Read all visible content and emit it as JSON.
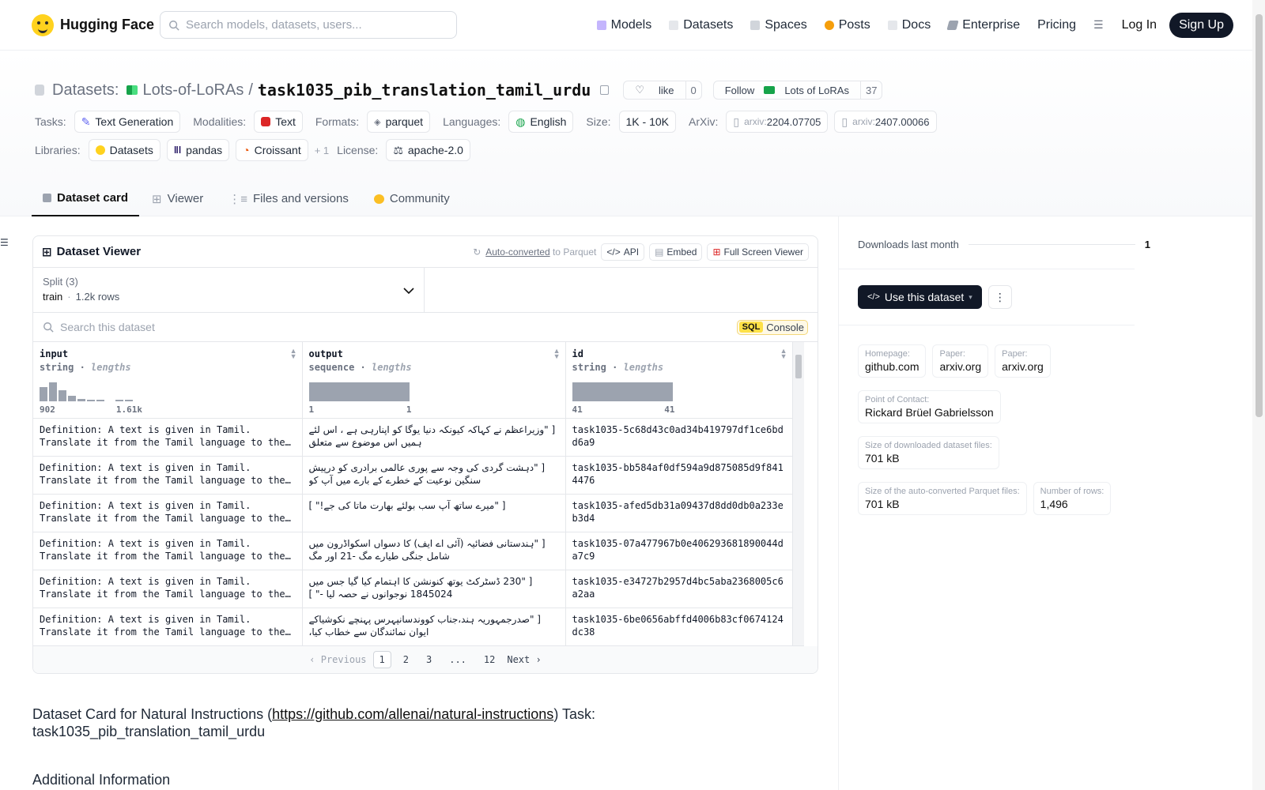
{
  "header": {
    "brand": "Hugging Face",
    "search_placeholder": "Search models, datasets, users...",
    "nav": [
      {
        "label": "Models",
        "icon": "cube-icon",
        "color": "#a78bfa"
      },
      {
        "label": "Datasets",
        "icon": "database-icon",
        "color": "#f87171"
      },
      {
        "label": "Spaces",
        "icon": "grid-icon",
        "color": "#60a5fa"
      },
      {
        "label": "Posts",
        "icon": "chat-icon",
        "color": "#f59e0b"
      },
      {
        "label": "Docs",
        "icon": "book-icon",
        "color": "#9ca3af"
      },
      {
        "label": "Enterprise",
        "icon": "enterprise-icon",
        "color": "#6b7280"
      },
      {
        "label": "Pricing"
      }
    ],
    "login": "Log In",
    "signup": "Sign Up"
  },
  "repo": {
    "section": "Datasets:",
    "owner": "Lots-of-LoRAs",
    "slash": "/",
    "name": "task1035_pib_translation_tamil_urdu",
    "like_label": "like",
    "like_count": "0",
    "follow_label": "Follow",
    "follow_org": "Lots of LoRAs",
    "follow_count": "37"
  },
  "meta": {
    "tasks_label": "Tasks:",
    "task": "Text Generation",
    "modalities_label": "Modalities:",
    "modality": "Text",
    "formats_label": "Formats:",
    "format": "parquet",
    "languages_label": "Languages:",
    "language": "English",
    "size_label": "Size:",
    "size": "1K - 10K",
    "arxiv_label": "ArXiv:",
    "arxiv_prefix": "arxiv:",
    "arxiv1": "2204.07705",
    "arxiv2": "2407.00066",
    "libraries_label": "Libraries:",
    "lib1": "Datasets",
    "lib2": "pandas",
    "lib3": "Croissant",
    "lib_more": "+ 1",
    "license_label": "License:",
    "license": "apache-2.0"
  },
  "tabs": [
    {
      "label": "Dataset card"
    },
    {
      "label": "Viewer"
    },
    {
      "label": "Files and versions"
    },
    {
      "label": "Community"
    }
  ],
  "viewer": {
    "title": "Dataset Viewer",
    "auto_converted": "Auto-converted",
    "to_parquet": " to Parquet",
    "api": "API",
    "embed": "Embed",
    "fullscreen": "Full Screen Viewer",
    "split_label": "Split (3)",
    "split_name": "train",
    "split_rows": "1.2k rows",
    "search_placeholder": "Search this dataset",
    "sql": "SQL",
    "console": "Console",
    "columns": [
      {
        "name": "input",
        "type": "string",
        "stat": "lengths",
        "min": "902",
        "max": "1.61k"
      },
      {
        "name": "output",
        "type": "sequence",
        "stat": "lengths",
        "min": "1",
        "max": "1"
      },
      {
        "name": "id",
        "type": "string",
        "stat": "lengths",
        "min": "41",
        "max": "41"
      }
    ],
    "rows": [
      {
        "input": "Definition: A text is given in Tamil. Translate it from the Tamil language to the Urdu…",
        "output": "[ \"وزیراعظم نے کہاکہ کیونکہ دنیا یوگا کو اپنارہی ہے ، اس لئے ہمیں اس موضوع سے متعلق",
        "id": "task1035-5c68d43c0ad34b419797df1ce6bdd6a9"
      },
      {
        "input": "Definition: A text is given in Tamil. Translate it from the Tamil language to the Urdu…",
        "output": "[ \"دہشت گردی کی وجہ سے پوری عالمی برادری کو درپیش سنگین نوعیت کے خطرے کے بارے میں آپ کو",
        "id": "task1035-bb584af0df594a9d875085d9f8414476"
      },
      {
        "input": "Definition: A text is given in Tamil. Translate it from the Tamil language to the Urdu…",
        "output": "[ \"میرے ساتھ آپ سب بولئے بھارت ماتا کی جے!\" ]",
        "id": "task1035-afed5db31a09437d8dd0db0a233eb3d4"
      },
      {
        "input": "Definition: A text is given in Tamil. Translate it from the Tamil language to the Urdu…",
        "output": "[ \"ہندستانی فضائیہ (آئی اے ایف) کا دسواں اسکواڈرون میں شامل جنگی طیارے مگ -21 اور مگ",
        "id": "task1035-07a477967b0e406293681890044da7c9"
      },
      {
        "input": "Definition: A text is given in Tamil. Translate it from the Tamil language to the Urdu…",
        "output": "[ \"230 ڈسٹرکٹ یوتھ کنونشن کا اہتمام کیا گیا جس میں 1845024 نوجوانوں نے حصہ لیا -\" ]",
        "id": "task1035-e34727b2957d4bc5aba2368005c6a2aa"
      },
      {
        "input": "Definition: A text is given in Tamil. Translate it from the Tamil language to the Urdu…",
        "output": "[ \"صدرجمہوریہ ہند،جناب کووندسانپہرس پہنچے نکوشیاکے ایوان نمائندگان سے خطاب کیا،",
        "id": "task1035-6be0656abffd4006b83cf0674124dc38"
      }
    ],
    "pager": {
      "prev": "Previous",
      "pages": [
        "1",
        "2",
        "3",
        "...",
        "12"
      ],
      "next": "Next"
    }
  },
  "card": {
    "title_pre": "Dataset Card for Natural Instructions (",
    "link": "https://github.com/allenai/natural-instructions",
    "title_post": ") Task: task1035_pib_translation_tamil_urdu",
    "h2": "Additional Information"
  },
  "sidebar": {
    "downloads_label": "Downloads last month",
    "downloads": "1",
    "use_button": "Use this dataset",
    "info": [
      {
        "k": "Homepage:",
        "v": "github.com"
      },
      {
        "k": "Paper:",
        "v": "arxiv.org"
      },
      {
        "k": "Paper:",
        "v": "arxiv.org"
      },
      {
        "k": "Point of Contact:",
        "v": "Rickard Brüel Gabrielsson"
      },
      {
        "k": "Size of downloaded dataset files:",
        "v": "701 kB"
      },
      {
        "k": "Size of the auto-converted Parquet files:",
        "v": "701 kB"
      },
      {
        "k": "Number of rows:",
        "v": "1,496"
      }
    ]
  }
}
